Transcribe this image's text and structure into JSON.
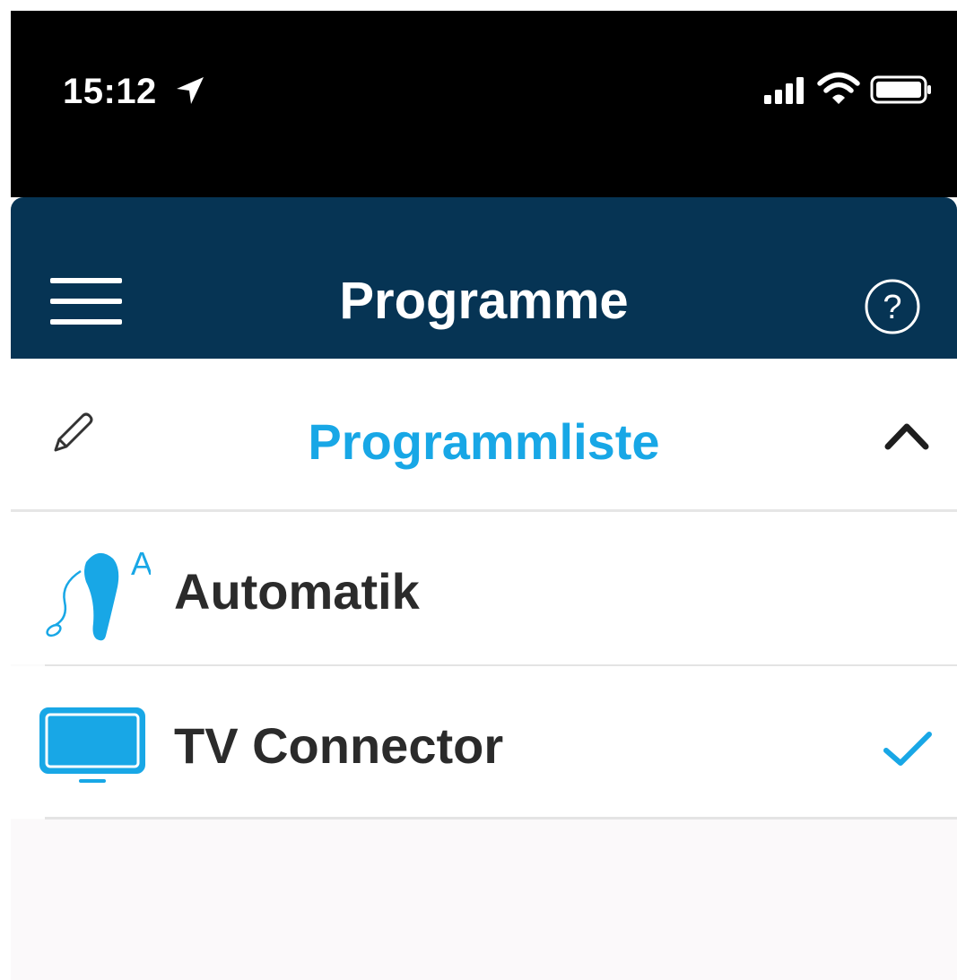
{
  "status_bar": {
    "time": "15:12",
    "location_icon": "location-arrow-icon",
    "signal_icon": "cellular-signal-icon",
    "wifi_icon": "wifi-icon",
    "battery_icon": "battery-icon"
  },
  "nav_bar": {
    "title": "Programme",
    "menu_icon": "hamburger-menu-icon",
    "help_icon": "help-circle-icon",
    "background_color": "#063454"
  },
  "program_list": {
    "title": "Programmliste",
    "edit_icon": "pencil-icon",
    "collapse_icon": "chevron-up-icon",
    "accent_color": "#18a7e6",
    "items": [
      {
        "label": "Automatik",
        "icon": "hearing-aid-automatic-icon",
        "selected": false
      },
      {
        "label": "TV Connector",
        "icon": "tv-icon",
        "selected": true
      }
    ]
  }
}
